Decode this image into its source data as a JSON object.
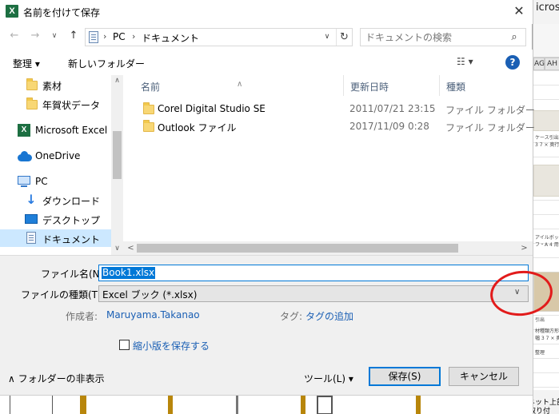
{
  "window": {
    "title": "名前を付けて保存",
    "app_icon": "excel-icon",
    "close_glyph": "✕"
  },
  "nav": {
    "back_glyph": "←",
    "forward_glyph": "→",
    "recent_glyph": "∨",
    "up_glyph": "↑",
    "address": {
      "crumbs": [
        "PC",
        "ドキュメント"
      ],
      "separator": "›",
      "dropdown_glyph": "∨",
      "refresh_glyph": "↻"
    },
    "search": {
      "placeholder": "ドキュメントの検索",
      "icon_glyph": "⌕"
    }
  },
  "toolbar": {
    "organize_label": "整理 ▾",
    "new_folder_label": "新しいフォルダー",
    "view_glyph": "☷ ▾",
    "help_glyph": "?"
  },
  "sidebar": {
    "items": [
      {
        "label": "素材",
        "icon": "folder-icon"
      },
      {
        "label": "年賀状データ",
        "icon": "folder-icon"
      },
      {
        "label": "Microsoft Excel",
        "icon": "excel-icon"
      },
      {
        "label": "OneDrive",
        "icon": "cloud-icon"
      },
      {
        "label": "PC",
        "icon": "pc-icon"
      },
      {
        "label": "ダウンロード",
        "icon": "download-icon"
      },
      {
        "label": "デスクトップ",
        "icon": "desktop-icon"
      },
      {
        "label": "ドキュメント",
        "icon": "documents-icon",
        "selected": true
      }
    ],
    "scroll_up_glyph": "∧",
    "scroll_down_glyph": "∨"
  },
  "files": {
    "columns": {
      "name": "名前",
      "modified": "更新日時",
      "type": "種類"
    },
    "sort_glyph": "∧",
    "rows": [
      {
        "name": "Corel Digital Studio SE",
        "date": "2011/07/21 23:15",
        "type": "ファイル フォルダー"
      },
      {
        "name": "Outlook ファイル",
        "date": "2017/11/09 0:28",
        "type": "ファイル フォルダー"
      }
    ],
    "hscroll_left_glyph": "<",
    "hscroll_right_glyph": ">"
  },
  "form": {
    "filename_label": "ファイル名(N):",
    "filename_value": "Book1.xlsx",
    "filetype_label": "ファイルの種類(T):",
    "filetype_value": "Excel ブック (*.xlsx)",
    "filetype_chevron": "∨",
    "author_label": "作成者:",
    "author_value": "Maruyama.Takanao",
    "tags_label": "タグ:",
    "tags_value": "タグの追加",
    "thumbnail_label": "縮小版を保存する",
    "hide_folders_label": "∧  フォルダーの非表示",
    "tools_label": "ツール(L)   ▾",
    "save_label": "保存(S)",
    "cancel_label": "キャンセル"
  },
  "annotation": {
    "color": "#e21b1b"
  },
  "background": {
    "excel_title": "icroso",
    "columns": [
      "AG",
      "AH"
    ],
    "captions": [
      "ケース引出",
      "3 7 × 奥行 2",
      "アイルボック",
      "フ・A 4 用",
      "引出",
      "材種類方形バ",
      "幅 3 7 × 奥行",
      "整理"
    ],
    "footer_lines": [
      "キャビネット上部",
      "リを取り付"
    ]
  }
}
